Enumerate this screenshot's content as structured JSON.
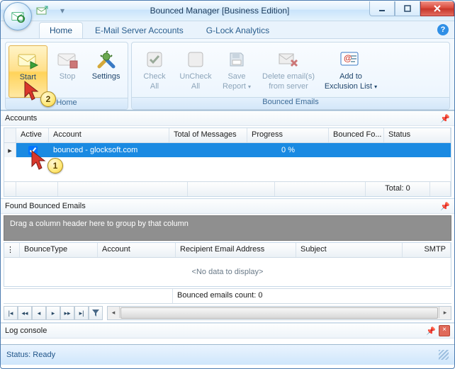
{
  "window": {
    "title": "Bounced Manager [Business Edition]"
  },
  "tabs": [
    {
      "label": "Home",
      "active": true
    },
    {
      "label": "E-Mail Server Accounts",
      "active": false
    },
    {
      "label": "G-Lock Analytics",
      "active": false
    }
  ],
  "ribbon": {
    "groups": [
      {
        "caption": "Home",
        "buttons": [
          {
            "name": "start-button",
            "label": "Start",
            "state": "hot"
          },
          {
            "name": "stop-button",
            "label": "Stop",
            "state": "disabled"
          },
          {
            "name": "settings-button",
            "label": "Settings",
            "state": "normal"
          }
        ]
      },
      {
        "caption": "Bounced Emails",
        "buttons": [
          {
            "name": "check-all-button",
            "label1": "Check",
            "label2": "All",
            "state": "disabled"
          },
          {
            "name": "uncheck-all-button",
            "label1": "UnCheck",
            "label2": "All",
            "state": "disabled"
          },
          {
            "name": "save-report-button",
            "label1": "Save",
            "label2": "Report",
            "state": "disabled",
            "dropdown": true
          },
          {
            "name": "delete-emails-button",
            "label1": "Delete email(s)",
            "label2": "from server",
            "state": "disabled",
            "wide": true
          },
          {
            "name": "add-exclusion-button",
            "label1": "Add to",
            "label2": "Exclusion List",
            "state": "normal",
            "dropdown": true,
            "wide": true
          }
        ]
      }
    ]
  },
  "accounts_panel": {
    "title": "Accounts",
    "columns": [
      "Active",
      "Account",
      "Total of Messages",
      "Progress",
      "Bounced Fo...",
      "Status"
    ],
    "row": {
      "active_checked": true,
      "account": "bounced - glocksoft.com",
      "total": "",
      "progress": "0 %",
      "bounced": "",
      "status": ""
    },
    "footer_label": "Total: 0"
  },
  "found_panel": {
    "title": "Found Bounced Emails",
    "group_hint": "Drag a column header here to group by that column",
    "columns": [
      "BounceType",
      "Account",
      "Recipient Email Address",
      "Subject",
      "SMTP"
    ],
    "empty_text": "<No data to display>",
    "count_label": "Bounced emails count: 0"
  },
  "log_panel": {
    "title": "Log console"
  },
  "status": {
    "text": "Status: Ready"
  },
  "callouts": {
    "one": "1",
    "two": "2"
  }
}
